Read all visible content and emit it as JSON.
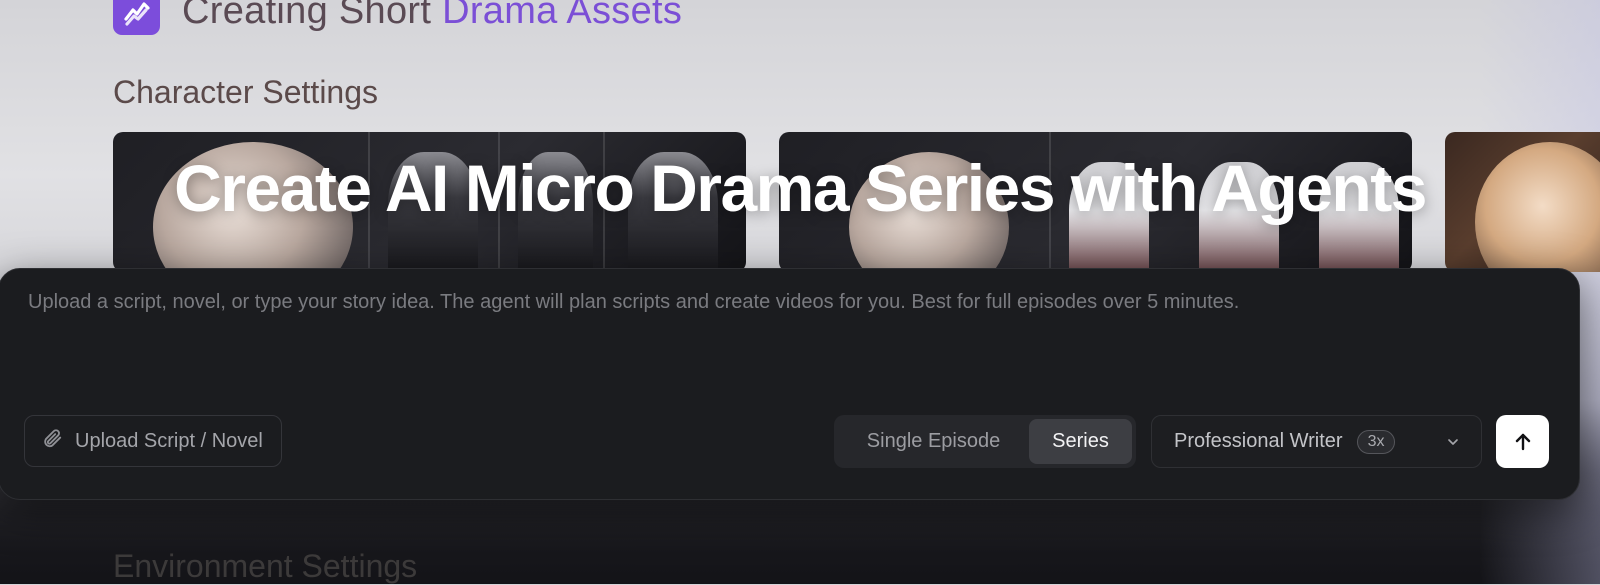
{
  "header": {
    "title_main": "Creating Short ",
    "title_highlight": "Drama Assets",
    "logo_icon": "chart-bolt-icon",
    "brand_color": "#7c4ddb"
  },
  "sections": {
    "characters": "Character Settings",
    "environment": "Environment Settings"
  },
  "hero": {
    "title": "Create AI Micro Drama Series with Agents"
  },
  "composer": {
    "placeholder": "Upload a script, novel, or type your story idea. The agent will plan scripts and create videos for you. Best for full episodes over 5 minutes.",
    "upload_label": "Upload Script / Novel",
    "upload_icon": "paperclip-icon",
    "modes": [
      "Single Episode",
      "Series"
    ],
    "selected_mode": "Series",
    "writer_label": "Professional Writer",
    "writer_badge": "3x",
    "writer_icon": "chevron-down-icon",
    "send_icon": "arrow-up-icon"
  }
}
